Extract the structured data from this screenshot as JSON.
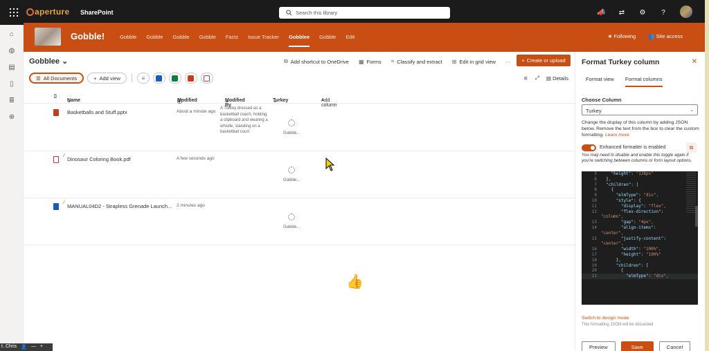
{
  "brand": {
    "logo": "aperture",
    "product": "SharePoint"
  },
  "search": {
    "placeholder": "Search this library"
  },
  "site": {
    "title": "Gobble!",
    "nav": [
      "Gobble",
      "Gobble",
      "Gobble",
      "Gobble",
      "Factz",
      "Issue Tracker",
      "Gobblee",
      "Gobble",
      "Edit"
    ],
    "active_nav": "Gobblee",
    "following": "Following",
    "site_access": "Site access"
  },
  "library": {
    "title": "Gobblee",
    "commands": {
      "shortcut": "Add shortcut to OneDrive",
      "forms": "Forms",
      "classify": "Classify and extract",
      "grid": "Edit in grid view",
      "more": "···",
      "create": "Create or upload"
    },
    "views": {
      "all_documents": "All Documents",
      "add_view": "Add view"
    },
    "details": "Details",
    "columns": {
      "name": "Name",
      "modified": "Modified",
      "modified_by": "Modified By",
      "turkey": "Turkey",
      "add_column": "Add column"
    },
    "rows": [
      {
        "name": "Basketballs and Stuff.pptx",
        "modified": "About a minute ago",
        "modified_by": "A Turkey dressed as a basketball coach, holding a clipboard and wearing a whistle, standing on a basketball court.",
        "turkey": "Gobble...",
        "file_color": "#c43e1c"
      },
      {
        "name": "Dinosaur Coloring Book.pdf",
        "modified": "A few seconds ago",
        "modified_by": "",
        "turkey": "Gobble...",
        "file_color": "#d13438"
      },
      {
        "name": "MANUAL04D2 - Strapless Grenade Launch...",
        "modified": "2 minutes ago",
        "modified_by": "",
        "turkey": "Gobble...",
        "file_color": "#185abd"
      }
    ]
  },
  "panel": {
    "title": "Format Turkey column",
    "tabs": [
      "Format view",
      "Format columns"
    ],
    "active_tab": "Format columns",
    "choose_column_label": "Choose Column",
    "choose_column_value": "Turkey",
    "description": "Change the display of this column by adding JSON below. Remove the text from the box to clear the custom formatting.",
    "learn_more": "Learn more",
    "toggle_label": "Enhanced formatter is enabled",
    "toggle_note": "You may need to disable and enable this toggle again if you're switching between columns or form layout options.",
    "code_lines": [
      {
        "n": "5",
        "t": "    \"height\": \"128px\""
      },
      {
        "n": "6",
        "t": "  },"
      },
      {
        "n": "7",
        "t": "  \"children\": ["
      },
      {
        "n": "8",
        "t": "    {"
      },
      {
        "n": "9",
        "t": "      \"elmType\": \"div\","
      },
      {
        "n": "10",
        "t": "      \"style\": {"
      },
      {
        "n": "11",
        "t": "        \"display\": \"flex\","
      },
      {
        "n": "12",
        "t": "        \"flex-direction\":"
      },
      {
        "n": "",
        "t": "\"column\","
      },
      {
        "n": "13",
        "t": "        \"gap\": \"4px\","
      },
      {
        "n": "14",
        "t": "        \"align-items\":"
      },
      {
        "n": "",
        "t": "\"center\","
      },
      {
        "n": "15",
        "t": "        \"justify-content\":"
      },
      {
        "n": "",
        "t": "\"center\","
      },
      {
        "n": "16",
        "t": "        \"width\": \"100%\","
      },
      {
        "n": "17",
        "t": "        \"height\": \"100%\""
      },
      {
        "n": "18",
        "t": "      },"
      },
      {
        "n": "19",
        "t": "      \"children\": ["
      },
      {
        "n": "20",
        "t": "        {"
      },
      {
        "n": "21",
        "t": "          \"elmType\": \"div\","
      }
    ],
    "switch_design": "Switch to design mode",
    "discard_note": "This formatting JSON will be discarded",
    "buttons": {
      "preview": "Preview",
      "save": "Save",
      "cancel": "Cancel"
    }
  },
  "taskbar": {
    "label": "t. Chris"
  },
  "colors": {
    "accent": "#c94e14",
    "topbar": "#1b1b1b",
    "editor_bg": "#1e1e1e"
  }
}
